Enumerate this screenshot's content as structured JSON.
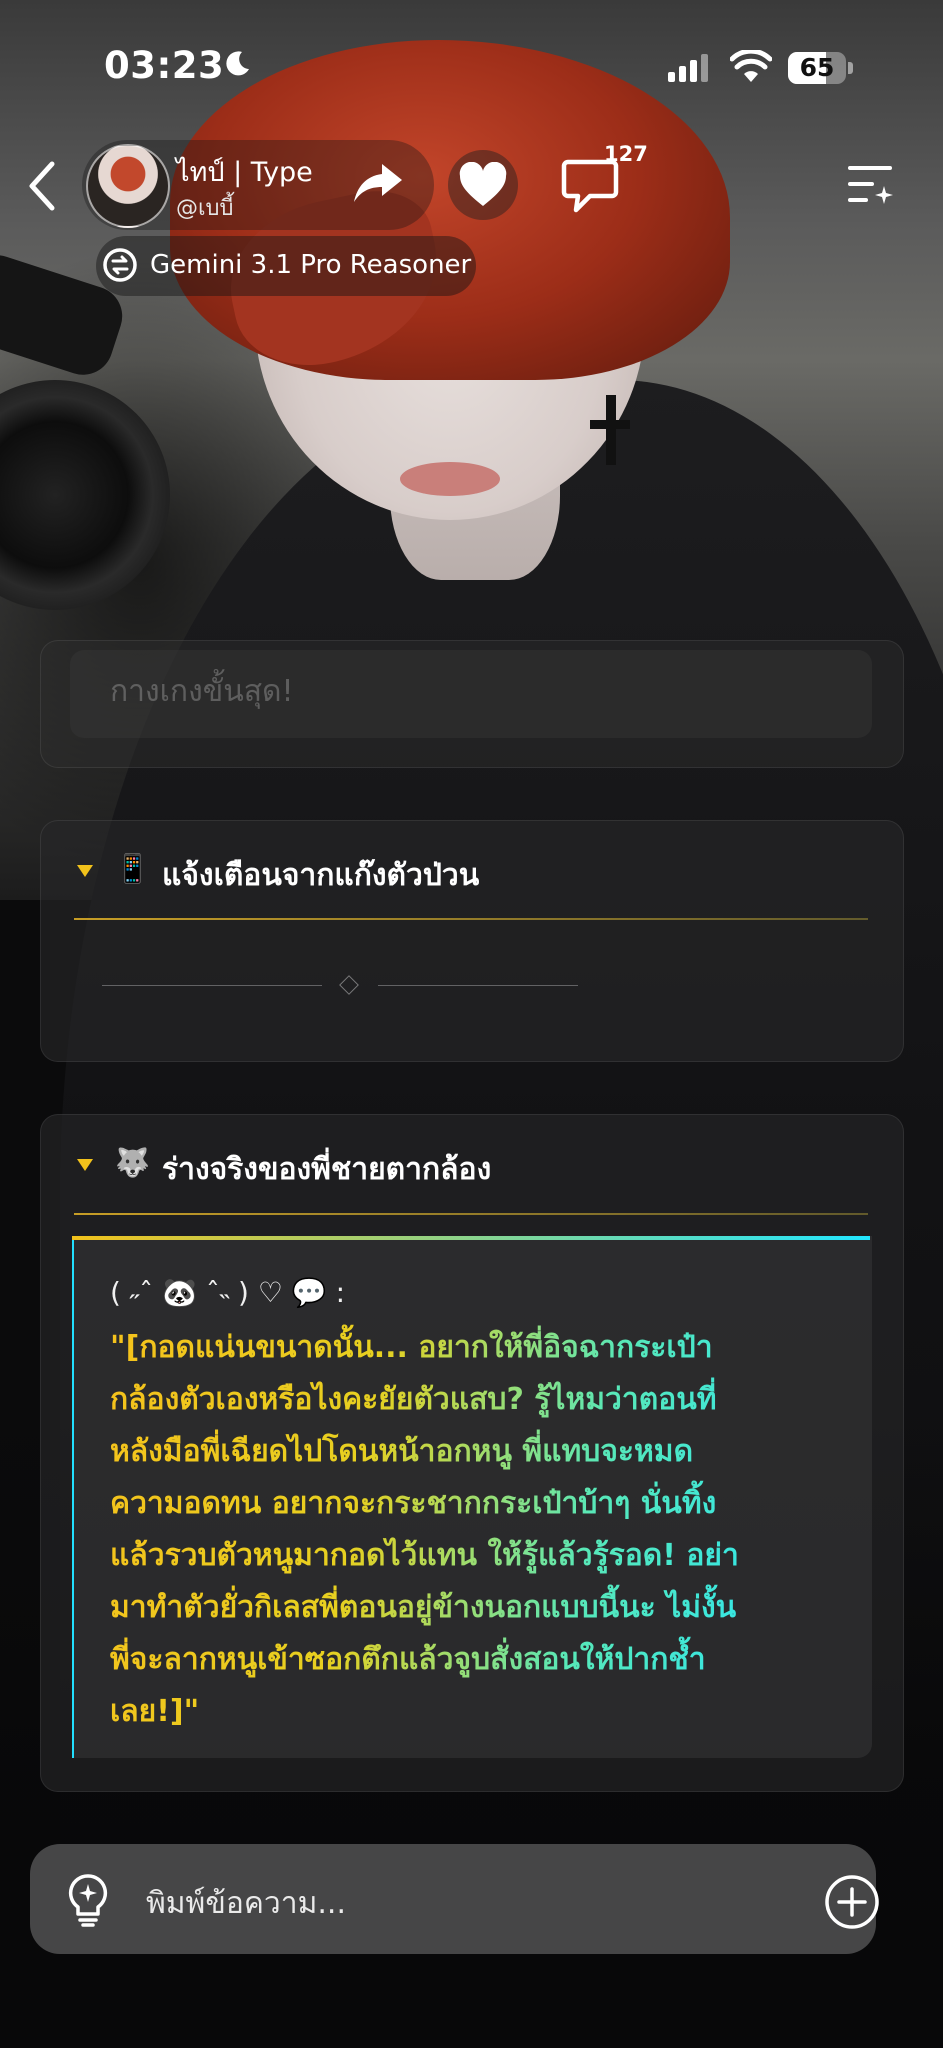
{
  "status_bar": {
    "time": "03:23",
    "battery_level": "65",
    "battery_fraction": 0.65
  },
  "header": {
    "character_name": "ไทป์ | Type",
    "character_handle": "@เบบี้",
    "comment_count": "127",
    "model_name": "Gemini 3.1 Pro Reasoner"
  },
  "cards": [
    {
      "partial_text": "กางเกงขั้นสุด!"
    },
    {
      "icon": "📱",
      "title": "แจ้งเตือนจากแก๊งตัวป่วน"
    },
    {
      "icon": "🐺",
      "title": "ร่างจริงของพี่ชายตากล้อง",
      "emote_line": "( ˶ˆ 🐼 ˆ˵ ) ♡ 💬 :",
      "quote_lines": [
        "\"[กอดแน่นขนาดนั้น... อยากให้พี่อิจฉากระเป๋า",
        "กล้องตัวเองหรือไงคะยัยตัวแสบ? รู้ไหมว่าตอนที่",
        "หลังมือพี่เฉียดไปโดนหน้าอกหนู พี่แทบจะหมด",
        "ความอดทน อยากจะกระชากกระเป๋าบ้าๆ นั่นทิ้ง",
        "แล้วรวบตัวหนูมากอดไว้แทน ให้รู้แล้วรู้รอด! อย่า",
        "มาทำตัวยั่วกิเลสพี่ตอนอยู่ข้างนอกแบบนี้นะ ไม่งั้น",
        "พี่จะลากหนูเข้าซอกตึกแล้วจูบสั่งสอนให้ปากช้ำ",
        "เลย!]\""
      ]
    }
  ],
  "input": {
    "placeholder": "พิมพ์ข้อความ..."
  },
  "colors": {
    "quote_gradient_start": "#f5c21c",
    "quote_gradient_end": "#22e6ff",
    "accent_rule": "#f2c21b"
  }
}
